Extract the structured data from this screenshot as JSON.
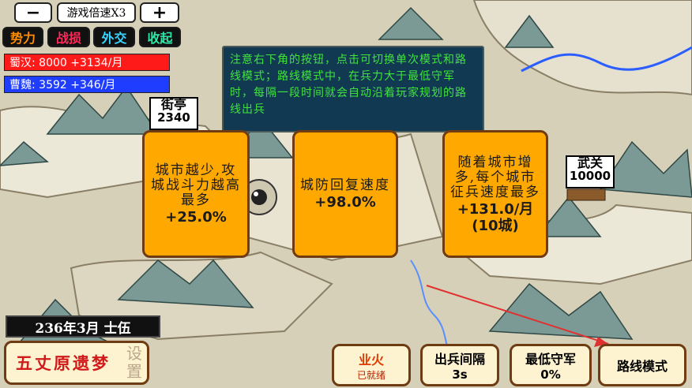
{
  "speed": {
    "minus": "−",
    "label": "游戏倍速X3",
    "plus": "+"
  },
  "tabs": [
    {
      "label": "势力",
      "color": "#ff8c00"
    },
    {
      "label": "战损",
      "color": "#ff2a5a"
    },
    {
      "label": "外交",
      "color": "#37d4ff"
    },
    {
      "label": "收起",
      "color": "#2ee8a8"
    }
  ],
  "factions": [
    {
      "label": "蜀汉: 8000 +3134/月",
      "color": "#ff1a1a"
    },
    {
      "label": "曹魏: 3592 +346/月",
      "color": "#1f3dff"
    }
  ],
  "tip": "注意右下角的按钮，点击可切换单次模式和路线模式；路线模式中，在兵力大于最低守军时，每隔一段时间就会自动沿着玩家规划的路线出兵",
  "cities": [
    {
      "name": "街亭",
      "troops": "2340"
    },
    {
      "name": "武关",
      "troops": "10000"
    }
  ],
  "cards": [
    {
      "text": "城市越少,攻城战斗力越高最多",
      "value": "+25.0%"
    },
    {
      "text": "城防回复速度",
      "value": "+98.0%"
    },
    {
      "text": "随着城市增多,每个城市征兵速度最多",
      "value": "+131.0/月",
      "sub": "(10城)"
    }
  ],
  "date": "236年3月  士伍",
  "game_title": "五丈原遗梦",
  "settings_label": "设置",
  "bottom_buttons": [
    {
      "top": "业火",
      "bottom": "已就绪",
      "top_color": "#e03a00",
      "bottom_color": "#c02000"
    },
    {
      "top": "出兵间隔",
      "bottom": "3s"
    },
    {
      "top": "最低守军",
      "bottom": "0%"
    },
    {
      "top": "路线模式",
      "bottom": ""
    }
  ]
}
